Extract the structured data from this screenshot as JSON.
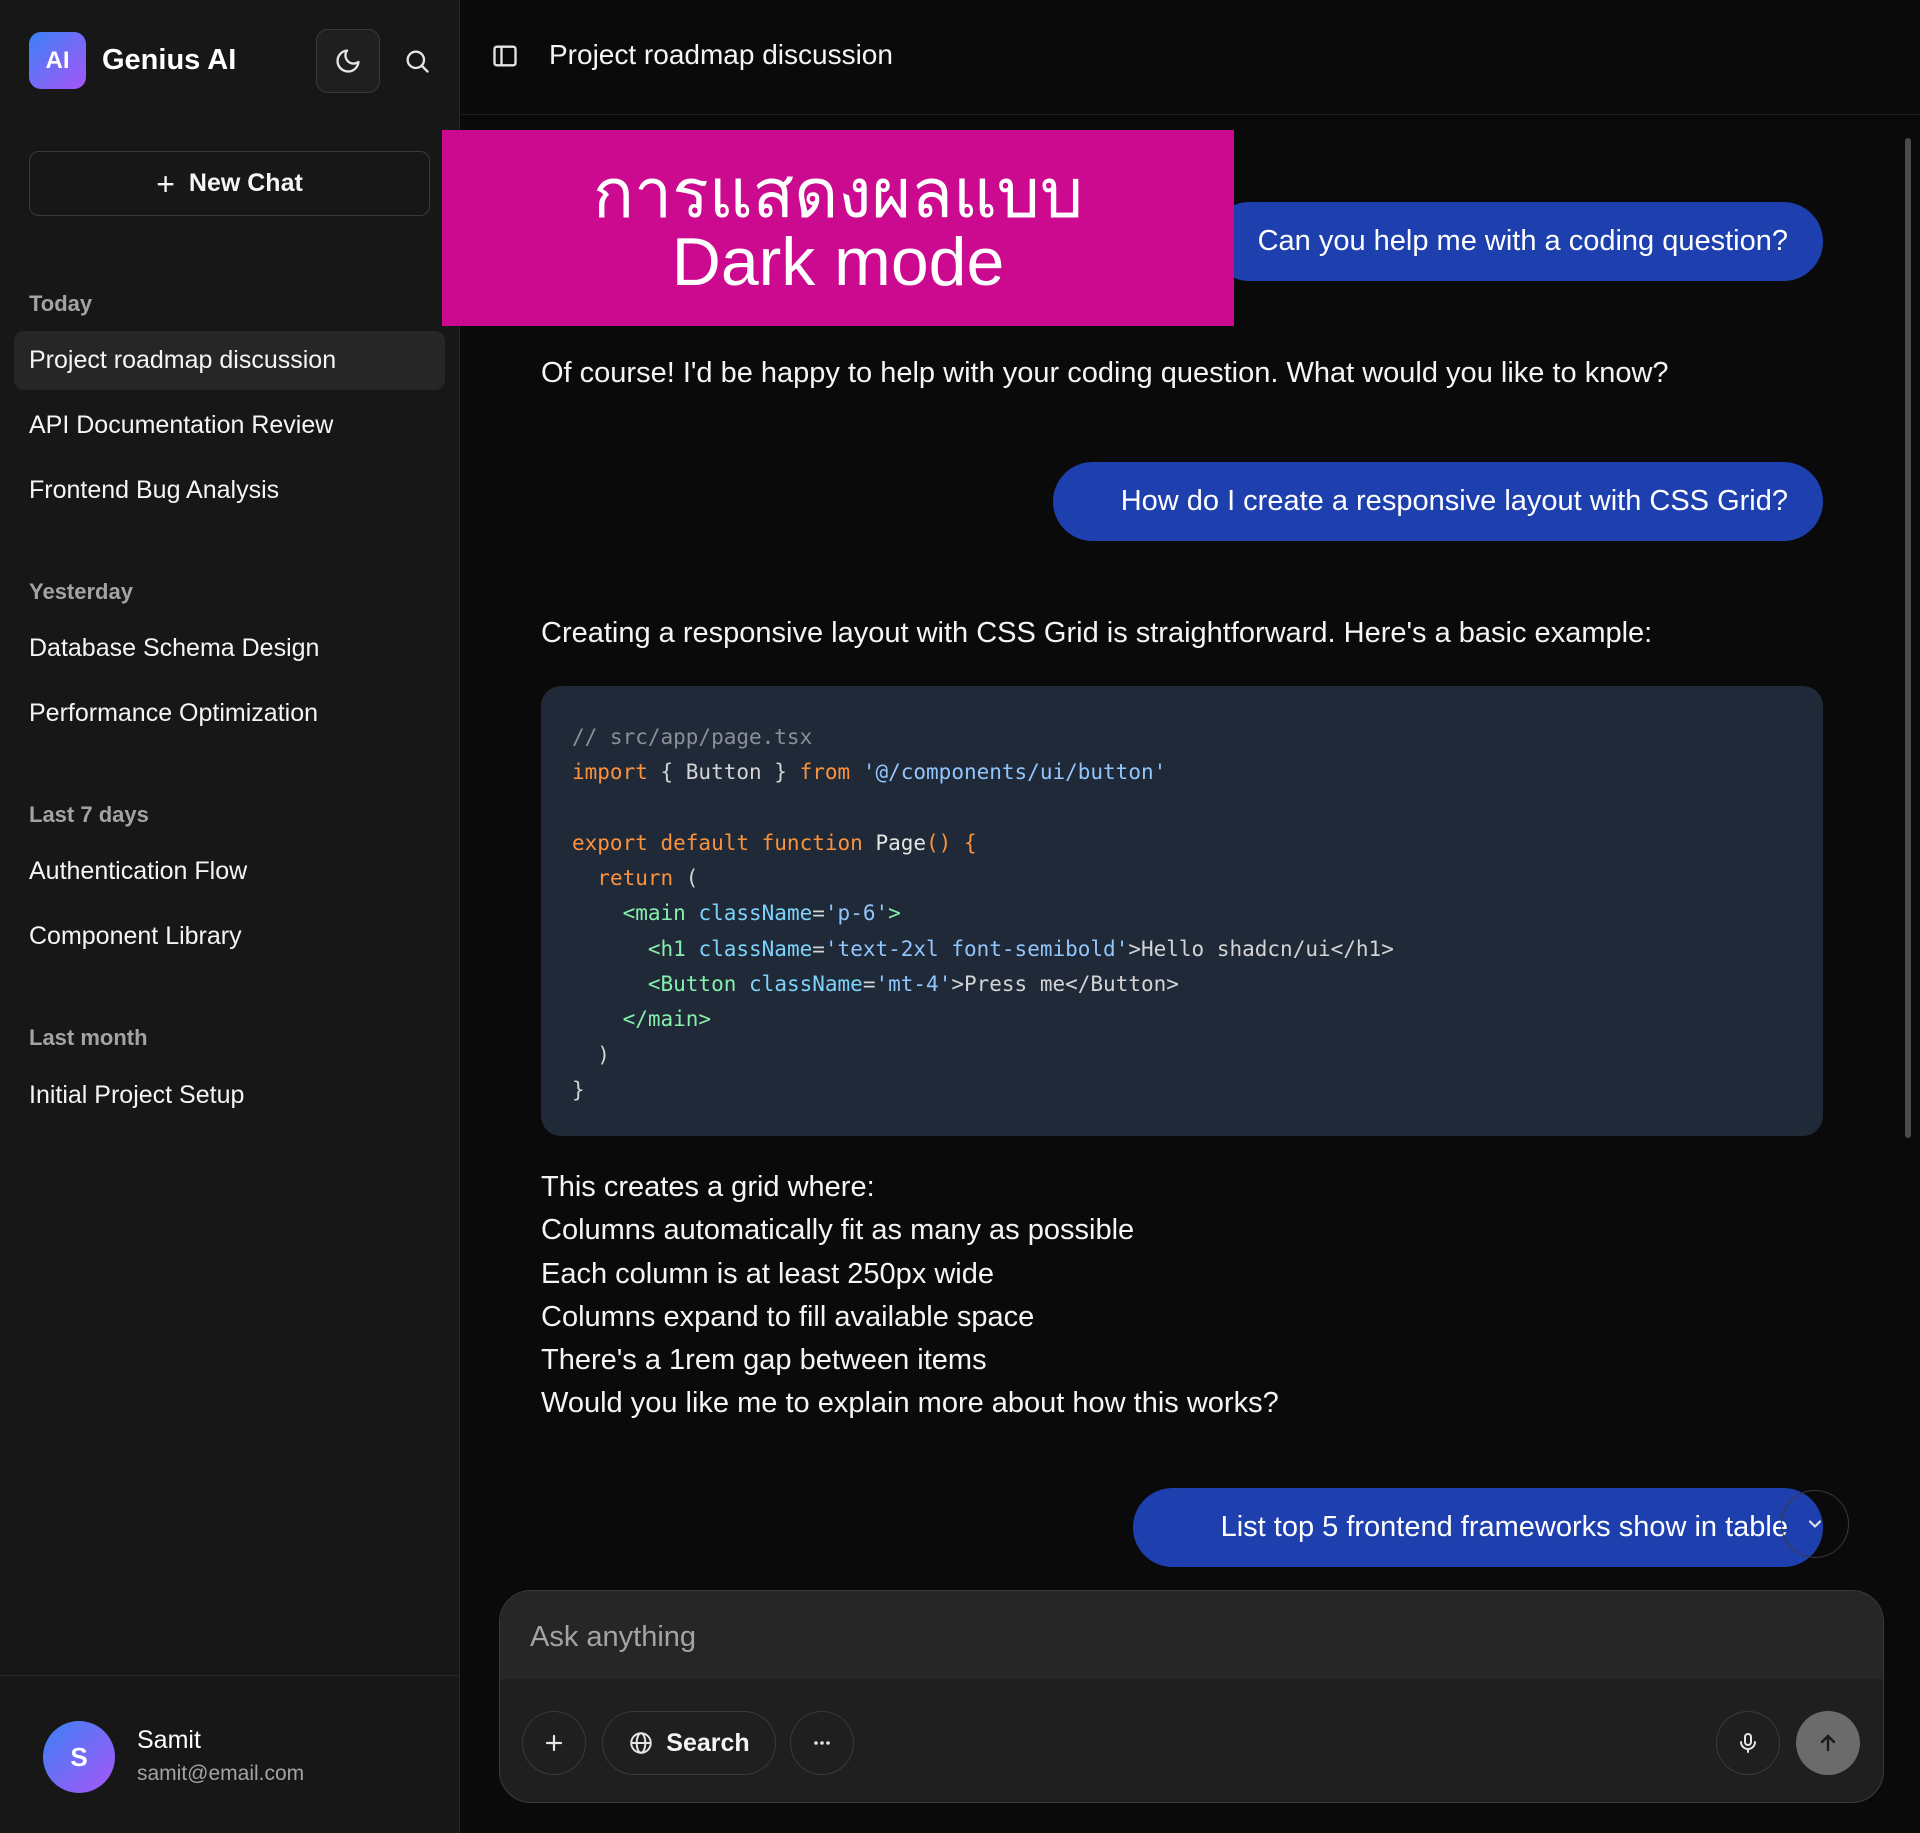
{
  "sidebar": {
    "brand": {
      "logo_text": "AI",
      "name": "Genius AI"
    },
    "new_chat_label": "New Chat",
    "groups": [
      {
        "label": "Today",
        "items": [
          {
            "label": "Project roadmap discussion",
            "active": true
          },
          {
            "label": "API Documentation Review"
          },
          {
            "label": "Frontend Bug Analysis"
          }
        ]
      },
      {
        "label": "Yesterday",
        "items": [
          {
            "label": "Database Schema Design"
          },
          {
            "label": "Performance Optimization"
          }
        ]
      },
      {
        "label": "Last 7 days",
        "items": [
          {
            "label": "Authentication Flow"
          },
          {
            "label": "Component Library"
          }
        ]
      },
      {
        "label": "Last month",
        "items": [
          {
            "label": "Initial Project Setup"
          }
        ]
      }
    ],
    "user": {
      "initial": "S",
      "name": "Samit",
      "email": "samit@email.com"
    }
  },
  "header": {
    "title": "Project roadmap discussion"
  },
  "overlay": {
    "line1": "การแสดงผลแบบ",
    "line2": "Dark mode"
  },
  "messages": {
    "user_1": "Can you help me with a coding question?",
    "ai_1": "Of course! I'd be happy to help with your coding question. What would you like to know?",
    "user_2": "How do I create a responsive layout with CSS Grid?",
    "ai_2_intro": "Creating a responsive layout with CSS Grid is straightforward. Here's a basic example:",
    "code": {
      "comment": "// src/app/page.tsx",
      "import_kw": "import",
      "import_names": " { Button } ",
      "from_kw": "from",
      "import_path": "'@/components/ui/button'",
      "export_kw": "export default function",
      "fn_name": " Page",
      "fn_tail": "() {",
      "return_kw": "return",
      "return_tail": " (",
      "main_open": "<main",
      "main_attr": "className",
      "main_val": "'p-6'",
      "main_close": ">",
      "h1_open": "<h1",
      "h1_attr": "className",
      "h1_val": "'text-2xl font-semibold'",
      "h1_text": ">Hello shadcn/ui</h1>",
      "btn_open": "<Button",
      "btn_attr": "className",
      "btn_val": "'mt-4'",
      "btn_text": ">Press me</Button>",
      "main_end": "</main>",
      "paren_close": ")",
      "brace_close": "}"
    },
    "ai_2_points": [
      "This creates a grid where:",
      "Columns automatically fit as many as possible",
      "Each column is at least 250px wide",
      "Columns expand to fill available space",
      "There's a 1rem gap between items",
      "Would you like me to explain more about how this works?"
    ],
    "user_3": "List  top 5 frontend frameworks show in table"
  },
  "composer": {
    "placeholder": "Ask anything",
    "search_label": "Search"
  },
  "colors": {
    "accent_bubble": "#1e40af",
    "overlay": "#cc0a8f",
    "brand_gradient_start": "#3b82f6",
    "brand_gradient_end": "#a855f7"
  },
  "icons": [
    "moon-icon",
    "search-icon",
    "plus-icon",
    "sidebar-panel-icon",
    "globe-icon",
    "more-icon",
    "mic-icon",
    "arrow-up-icon",
    "chevron-down-icon"
  ]
}
